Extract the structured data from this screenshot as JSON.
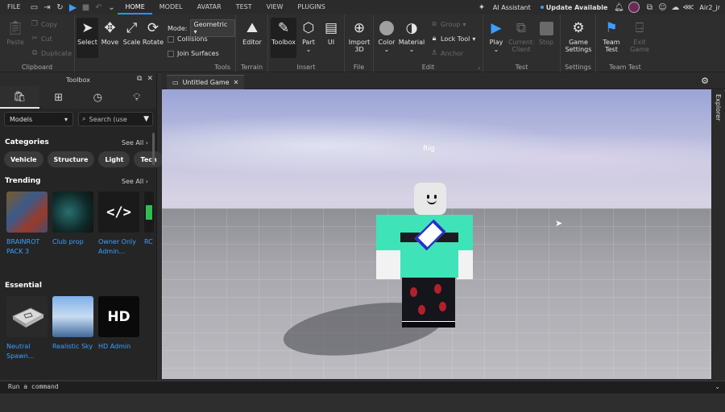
{
  "menubar": {
    "file_label": "FILE",
    "tabs": [
      {
        "label": "HOME",
        "active": true
      },
      {
        "label": "MODEL",
        "active": false
      },
      {
        "label": "AVATAR",
        "active": false
      },
      {
        "label": "TEST",
        "active": false
      },
      {
        "label": "VIEW",
        "active": false
      },
      {
        "label": "PLUGINS",
        "active": false
      }
    ],
    "ai_assistant_label": "AI Assistant",
    "update_label": "Update Available",
    "username": "Air2_jr"
  },
  "ribbon": {
    "clipboard": {
      "label": "Clipboard",
      "paste": "Paste",
      "copy": "Copy",
      "cut": "Cut",
      "duplicate": "Duplicate"
    },
    "tools": {
      "label": "Tools",
      "select": "Select",
      "move": "Move",
      "scale": "Scale",
      "rotate": "Rotate",
      "mode_label": "Mode:",
      "mode_value": "Geometric",
      "collisions": "Collisions",
      "join_surfaces": "Join Surfaces"
    },
    "terrain": {
      "label": "Terrain",
      "editor": "Editor"
    },
    "insert": {
      "label": "Insert",
      "toolbox": "Toolbox",
      "part": "Part",
      "ui": "UI"
    },
    "file": {
      "label": "File",
      "import_3d": "Import 3D"
    },
    "edit": {
      "label": "Edit",
      "color": "Color",
      "material": "Material",
      "group": "Group",
      "lock_tool": "Lock Tool",
      "anchor": "Anchor"
    },
    "test": {
      "label": "Test",
      "play": "Play",
      "current_client": "Current: Client",
      "stop": "Stop"
    },
    "settings": {
      "label": "Settings",
      "game_settings": "Game Settings"
    },
    "team_test": {
      "label": "Team Test",
      "team_test": "Team Test",
      "exit_game": "Exit Game"
    }
  },
  "toolbox": {
    "title": "Toolbox",
    "category_select": "Models",
    "search_placeholder": "Search (use",
    "categories": {
      "title": "Categories",
      "see_all": "See All",
      "chips": [
        "Vehicle",
        "Structure",
        "Light",
        "Tech"
      ]
    },
    "trending": {
      "title": "Trending",
      "see_all": "See All",
      "items": [
        {
          "label": "BRAINROT PACK 3"
        },
        {
          "label": "Club prop"
        },
        {
          "label": "Owner Only Admin..."
        },
        {
          "label": "RC"
        }
      ],
      "code_glyph": "</>"
    },
    "essential": {
      "title": "Essential",
      "items": [
        {
          "label": "Neutral Spawn..."
        },
        {
          "label": "Realistic Sky"
        },
        {
          "label": "HD Admin"
        }
      ],
      "hd_text": "HD"
    }
  },
  "viewport": {
    "tab_label": "Untitled Game",
    "rig_label": "Rig",
    "explorer_label": "Explorer"
  },
  "commandbar": {
    "placeholder": "Run a command"
  }
}
